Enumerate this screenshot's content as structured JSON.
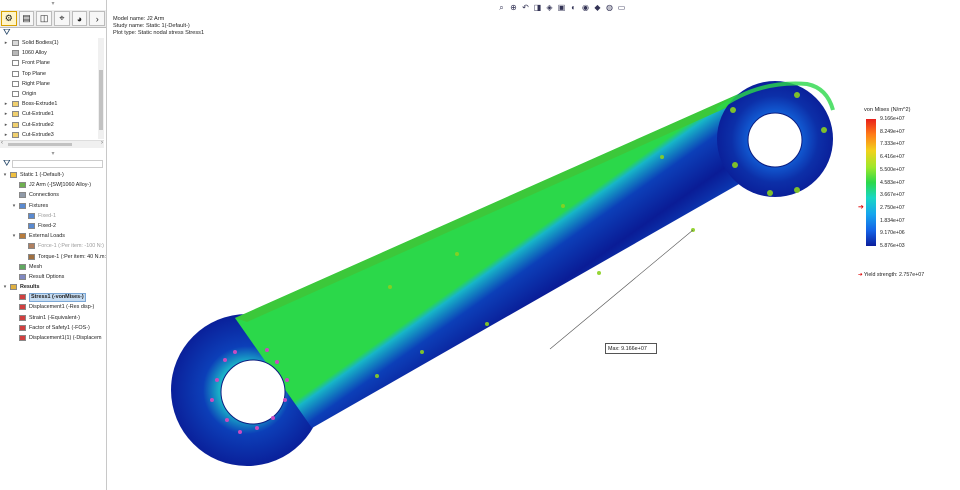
{
  "left_panel": {
    "tabs": [
      "feature-manager-icon",
      "property-manager-icon",
      "configuration-manager-icon",
      "dimxpert-icon",
      "display-manager-icon",
      "more-tabs-icon"
    ],
    "feature_tree": [
      {
        "label": "Solid Bodies(1)",
        "expandable": true,
        "icon": "solid-bodies-icon"
      },
      {
        "label": "1060 Alloy",
        "expandable": false,
        "icon": "material-icon"
      },
      {
        "label": "Front Plane",
        "expandable": false,
        "icon": "plane-icon"
      },
      {
        "label": "Top Plane",
        "expandable": false,
        "icon": "plane-icon"
      },
      {
        "label": "Right Plane",
        "expandable": false,
        "icon": "plane-icon"
      },
      {
        "label": "Origin",
        "expandable": false,
        "icon": "origin-icon"
      },
      {
        "label": "Boss-Extrude1",
        "expandable": true,
        "icon": "extrude-icon"
      },
      {
        "label": "Cut-Extrude1",
        "expandable": true,
        "icon": "cut-icon"
      },
      {
        "label": "Cut-Extrude2",
        "expandable": true,
        "icon": "cut-icon"
      },
      {
        "label": "Cut-Extrude3",
        "expandable": true,
        "icon": "cut-icon"
      }
    ],
    "study_tree": [
      {
        "label": "Static 1 (-Default-)",
        "level": 0,
        "expand": "▾",
        "icon": "study-icon",
        "style": ""
      },
      {
        "label": "J2 Arm (-[SW]1060 Alloy-)",
        "level": 1,
        "expand": "",
        "icon": "part-icon",
        "style": ""
      },
      {
        "label": "Connections",
        "level": 1,
        "expand": "",
        "icon": "connections-icon",
        "style": ""
      },
      {
        "label": "Fixtures",
        "level": 1,
        "expand": "▾",
        "icon": "fixtures-icon",
        "style": ""
      },
      {
        "label": "Fixed-1",
        "level": 2,
        "expand": "",
        "icon": "fixed-icon",
        "style": "grey"
      },
      {
        "label": "Fixed-2",
        "level": 2,
        "expand": "",
        "icon": "fixed-icon",
        "style": ""
      },
      {
        "label": "External Loads",
        "level": 1,
        "expand": "▾",
        "icon": "loads-icon",
        "style": ""
      },
      {
        "label": "Force-1 (:Per item: -100 N:)",
        "level": 2,
        "expand": "",
        "icon": "force-icon",
        "style": "grey"
      },
      {
        "label": "Torque-1 (:Per item: 40 N.m:)",
        "level": 2,
        "expand": "",
        "icon": "torque-icon",
        "style": ""
      },
      {
        "label": "Mesh",
        "level": 1,
        "expand": "",
        "icon": "mesh-icon",
        "style": ""
      },
      {
        "label": "Result Options",
        "level": 1,
        "expand": "",
        "icon": "result-options-icon",
        "style": ""
      },
      {
        "label": "Results",
        "level": 0,
        "expand": "▾",
        "icon": "results-folder-icon",
        "style": "bold"
      },
      {
        "label": "Stress1 (-vonMises-)",
        "level": 1,
        "expand": "",
        "icon": "plot-icon",
        "style": "sel"
      },
      {
        "label": "Displacement1 (-Res disp-)",
        "level": 1,
        "expand": "",
        "icon": "plot-icon",
        "style": ""
      },
      {
        "label": "Strain1 (-Equivalent-)",
        "level": 1,
        "expand": "",
        "icon": "plot-icon",
        "style": ""
      },
      {
        "label": "Factor of Safety1 (-FOS-)",
        "level": 1,
        "expand": "",
        "icon": "plot-icon",
        "style": ""
      },
      {
        "label": "Displacement1(1) (-Displacem",
        "level": 1,
        "expand": "",
        "icon": "plot-icon",
        "style": ""
      }
    ]
  },
  "graphics": {
    "model_name": "Model name: J2 Arm",
    "study_name": "Study name: Static 1(-Default-)",
    "plot_type": "Plot type: Static nodal stress Stress1",
    "hud_icons": [
      "zoom-to-fit-icon",
      "zoom-area-icon",
      "previous-view-icon",
      "section-view-icon",
      "dynamic-annotation-icon",
      "view-orientation-icon",
      "display-style-icon",
      "hide-show-icon",
      "edit-appearance-icon",
      "apply-scene-icon",
      "view-settings-icon"
    ],
    "max_probe": "Max: 9.166e+07"
  },
  "legend": {
    "title": "von Mises (N/m^2)",
    "ticks": [
      "9.166e+07",
      "8.249e+07",
      "7.333e+07",
      "6.416e+07",
      "5.500e+07",
      "4.583e+07",
      "3.667e+07",
      "2.750e+07",
      "1.834e+07",
      "9.170e+06",
      "5.876e+03"
    ],
    "yield_marker_value": 27570000.0,
    "yield_label": "Yield strength: 2.757e+07",
    "colors": {
      "max": "#e8201c",
      "mid": "#2bd84a",
      "min": "#0c1e9c",
      "arrow": "#dd0000"
    }
  }
}
